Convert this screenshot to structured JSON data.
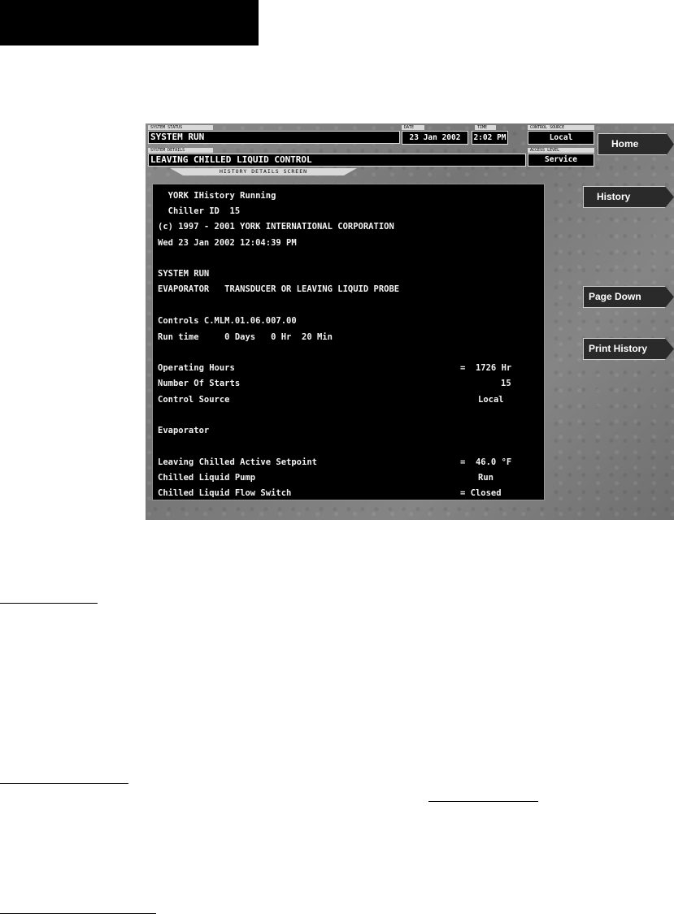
{
  "header": {
    "system_status_caption": "SYSTEM STATUS",
    "system_status": "SYSTEM RUN",
    "system_details_caption": "SYSTEM DETAILS",
    "system_details": "LEAVING CHILLED LIQUID CONTROL",
    "date_caption": "DATE",
    "date": "23 Jan 2002",
    "time_caption": "TIME",
    "time": "2:02 PM",
    "control_source_caption": "CONTROL SOURCE",
    "control_source": "Local",
    "access_level_caption": "ACCESS LEVEL",
    "access_level": "Service",
    "screen_name": "HISTORY DETAILS SCREEN"
  },
  "terminal": {
    "lines": [
      "  YORK IHistory Running",
      "  Chiller ID  15",
      "(c) 1997 - 2001 YORK INTERNATIONAL CORPORATION",
      "Wed 23 Jan 2002 12:04:39 PM",
      "SYSTEM RUN",
      "EVAPORATOR   TRANSDUCER OR LEAVING LIQUID PROBE",
      "Controls C.MLM.01.06.007.00",
      "Run time     0 Days   0 Hr  20 Min",
      "Operating Hours",
      "Number Of Starts",
      "Control Source",
      "Evaporator",
      "Leaving Chilled Active Setpoint",
      "Chilled Liquid Pump",
      "Chilled Liquid Flow Switch"
    ],
    "values": {
      "operating_hours": "=  1726 Hr",
      "number_of_starts": "15",
      "control_source": "Local",
      "setpoint": "=  46.0 °F",
      "pump": "Run",
      "flow_switch": "= Closed"
    }
  },
  "buttons": {
    "home": "Home",
    "history": "History",
    "page_down": "Page Down",
    "print_history": "Print History"
  }
}
